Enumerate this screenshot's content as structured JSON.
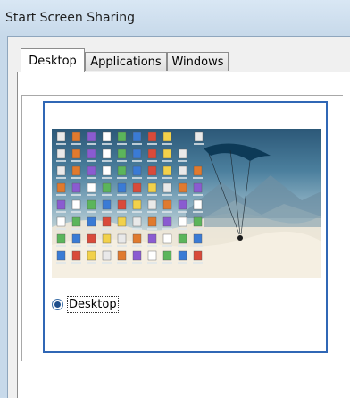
{
  "window": {
    "title": "Start Screen Sharing"
  },
  "tabs": [
    {
      "label": "Desktop",
      "selected": true
    },
    {
      "label": "Applications",
      "selected": false
    },
    {
      "label": "Windows",
      "selected": false
    }
  ],
  "desktop_option": {
    "label": "Desktop",
    "selected": true
  },
  "colors": {
    "accent": "#3067b5",
    "titlebar": "#c7d9ea"
  }
}
